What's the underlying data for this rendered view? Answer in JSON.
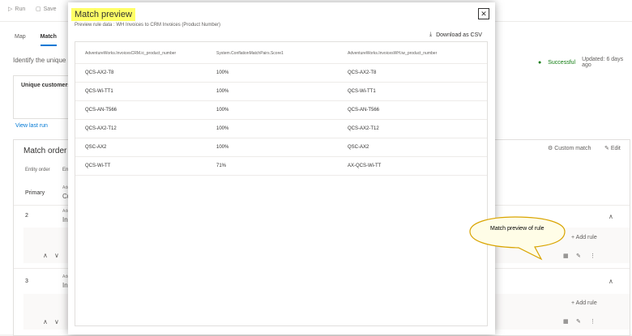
{
  "toolbar": {
    "run": "Run",
    "save": "Save"
  },
  "tabs": [
    {
      "label": "Map"
    },
    {
      "label": "Match"
    }
  ],
  "identify_text": "Identify the unique c",
  "status": {
    "state": "Successful",
    "updated": "Updated: 6 days ago"
  },
  "card": {
    "label": "Unique customers"
  },
  "view_last_run": "View last run",
  "match_order": {
    "title": "Match order",
    "col_entity_order": "Entity order",
    "col_entity": "Ent",
    "custom_match": "Custom match",
    "edit": "Edit",
    "rows": [
      {
        "label": "Primary",
        "sub": "Add",
        "val": "Cu"
      },
      {
        "label": "2",
        "sub": "Add",
        "val": "In"
      },
      {
        "label": "3",
        "sub": "Add",
        "val": "In"
      }
    ],
    "add_rule": "Add rule"
  },
  "modal": {
    "title": "Match preview",
    "subtitle": "Preview rule data : WH Invoices to CRM Invoices (Product Number)",
    "download": "Download as CSV",
    "columns": [
      "AdventureWorks.InvoicesCRM.ic_product_number",
      "System.ConflationMatchPairs.Score1",
      "AdventureWorks.InvoicesWH.iw_product_number"
    ],
    "rows": [
      [
        "QCS-AX2-T8",
        "100%",
        "QCS-AX2-T8"
      ],
      [
        "QCS-Wi-TT1",
        "100%",
        "QCS-Wi-TT1"
      ],
      [
        "QCS-AN-T566",
        "100%",
        "QCS-AN-T566"
      ],
      [
        "QCS-AX2-T12",
        "100%",
        "QCS-AX2-T12"
      ],
      [
        "QSC-AX2",
        "100%",
        "QSC-AX2"
      ],
      [
        "QCS-Wi-TT",
        "71%",
        "AX-QCS-Wi-TT"
      ]
    ]
  },
  "callout": {
    "text": "Match preview of rule"
  },
  "colors": {
    "accent": "#0078d4",
    "success": "#107c10",
    "highlight": "#ffff66",
    "callout_fill": "#fffde7",
    "callout_stroke": "#d9a400"
  }
}
